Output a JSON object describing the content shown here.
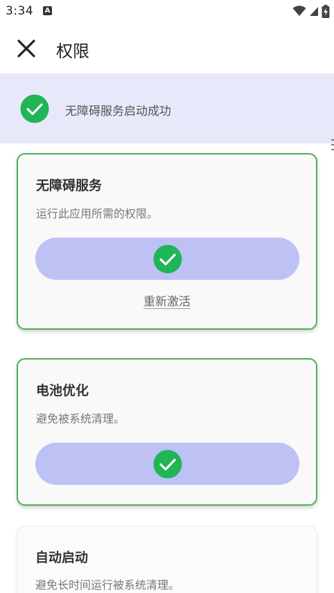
{
  "status_bar": {
    "time": "3:34",
    "app_icon_letter": "A",
    "icons": [
      "wifi-icon",
      "signal-icon",
      "battery-charging-icon"
    ]
  },
  "app_bar": {
    "title": "权限",
    "close_icon": "close-icon"
  },
  "banner": {
    "text": "无障碍服务启动成功",
    "icon": "check-circle-icon",
    "background": "#e8e8fb"
  },
  "cards": [
    {
      "title": "无障碍服务",
      "description": "运行此应用所需的权限。",
      "status": "granted",
      "action_label": "重新激活"
    },
    {
      "title": "电池优化",
      "description": "避免被系统清理。",
      "status": "granted"
    },
    {
      "title": "自动启动",
      "description": "避免长时间运行被系统清理。"
    }
  ],
  "colors": {
    "accent_green": "#4caf50",
    "check_green": "#20b556",
    "pill": "#bec1f4"
  }
}
